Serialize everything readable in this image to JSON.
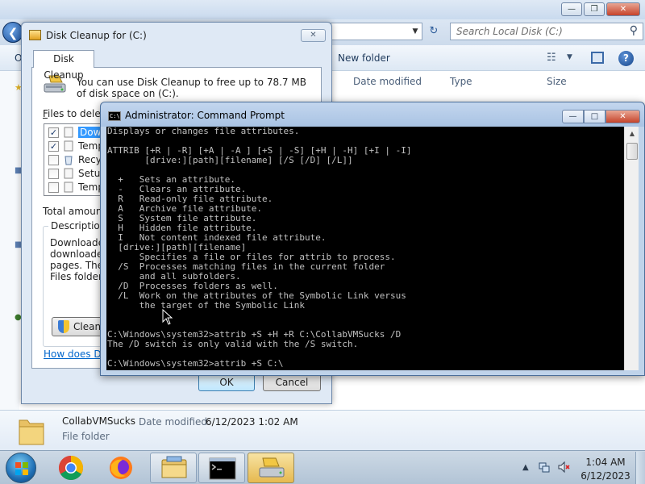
{
  "explorer": {
    "search_placeholder": "Search Local Disk (C:)",
    "toolbar": {
      "org_fragment": "O",
      "new_folder": "New folder"
    },
    "columns": {
      "date_modified": "Date modified",
      "type": "Type",
      "size": "Size"
    },
    "details": {
      "name": "CollabVMSucks",
      "modified_label": "Date modified:",
      "modified_value": "6/12/2023 1:02 AM",
      "type": "File folder"
    }
  },
  "disk_cleanup": {
    "title": "Disk Cleanup for  (C:)",
    "tab": "Disk Cleanup",
    "intro": "You can use Disk Cleanup to free up to 78.7 MB of disk space on  (C:).",
    "files_label_u": "F",
    "files_label_rest": "iles to delete:",
    "files": [
      {
        "name": "Downl",
        "checked": true,
        "selected": true
      },
      {
        "name": "Tempo",
        "checked": true,
        "selected": false
      },
      {
        "name": "Recyc",
        "checked": false,
        "selected": false
      },
      {
        "name": "Setup",
        "checked": false,
        "selected": false
      },
      {
        "name": "Tempo",
        "checked": false,
        "selected": false
      }
    ],
    "total_label": "Total amount o",
    "description_label": "Description",
    "description_lines": [
      "Downloaded",
      "downloaded",
      "pages. They",
      "Files folder on"
    ],
    "clean_button": "Clean u",
    "help_link": "How does Disk",
    "ok": "OK",
    "cancel": "Cancel"
  },
  "cmd": {
    "title": "Administrator: Command Prompt",
    "lines": [
      "Displays or changes file attributes.",
      "",
      "ATTRIB [+R | -R] [+A | -A ] [+S | -S] [+H | -H] [+I | -I]",
      "       [drive:][path][filename] [/S [/D] [/L]]",
      "",
      "  +   Sets an attribute.",
      "  -   Clears an attribute.",
      "  R   Read-only file attribute.",
      "  A   Archive file attribute.",
      "  S   System file attribute.",
      "  H   Hidden file attribute.",
      "  I   Not content indexed file attribute.",
      "  [drive:][path][filename]",
      "      Specifies a file or files for attrib to process.",
      "  /S  Processes matching files in the current folder",
      "      and all subfolders.",
      "  /D  Processes folders as well.",
      "  /L  Work on the attributes of the Symbolic Link versus",
      "      the target of the Symbolic Link",
      "",
      "",
      "C:\\Windows\\system32>attrib +S +H +R C:\\CollabVMSucks /D",
      "The /D switch is only valid with the /S switch.",
      "",
      "C:\\Windows\\system32>attrib +S C:\\"
    ]
  },
  "taskbar": {
    "apps": [
      "start-button",
      "chrome",
      "firefox",
      "windows-explorer",
      "command-prompt",
      "disk-cleanup"
    ],
    "time": "1:04 AM",
    "date": "6/12/2023"
  }
}
